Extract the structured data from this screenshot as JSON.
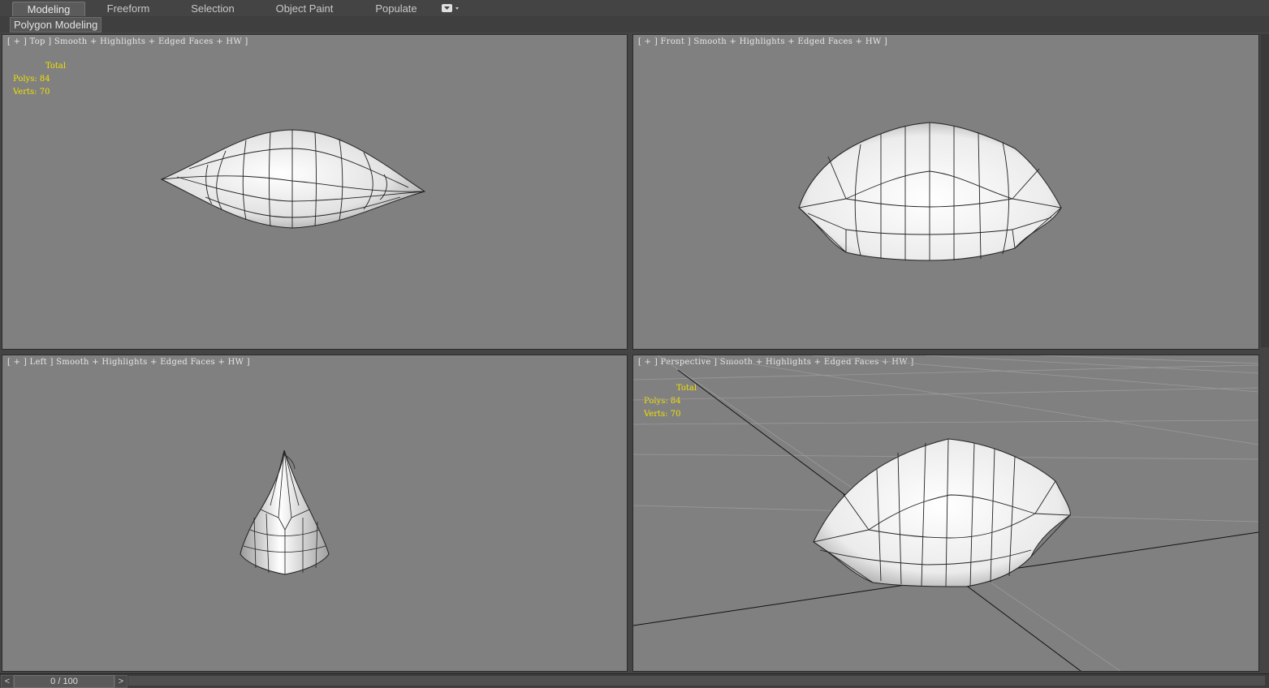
{
  "ribbon": {
    "tabs": [
      "Modeling",
      "Freeform",
      "Selection",
      "Object Paint",
      "Populate"
    ],
    "active": "Modeling",
    "sub_tab": "Polygon Modeling"
  },
  "viewports": {
    "top": {
      "label": "[ + ] Top ] Smooth + Highlights + Edged Faces + HW ]"
    },
    "front": {
      "label": "[ + ] Front ] Smooth + Highlights + Edged Faces + HW ]"
    },
    "left": {
      "label": "[ + ] Left ] Smooth + Highlights + Edged Faces + HW ]"
    },
    "perspective": {
      "label": "[ + ] Perspective ] Smooth + Highlights + Edged Faces + HW ]"
    }
  },
  "stats": {
    "total": "Total",
    "polys": "Polys: 84",
    "verts": "Verts: 70"
  },
  "timeline": {
    "frame": "0 / 100",
    "prev": "<",
    "next": ">"
  }
}
